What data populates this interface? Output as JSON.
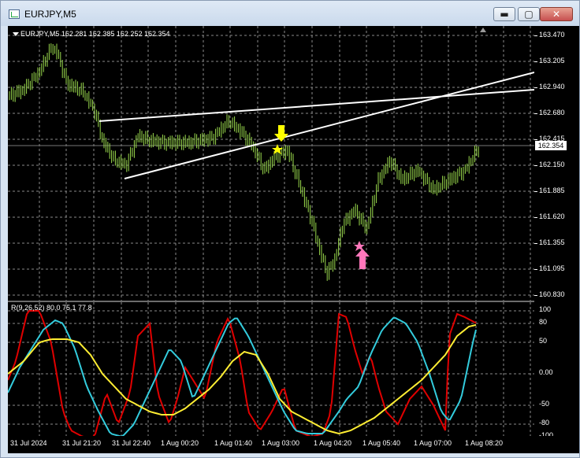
{
  "window": {
    "title": "EURJPY,M5",
    "minimize_glyph": "▬",
    "maximize_glyph": "▢",
    "close_glyph": "✕"
  },
  "header": {
    "text": "EURJPY,M5  162.281 162.385 162.252 162.354"
  },
  "indicator": {
    "header": "R(9,26,52) 80.0 75.1 77.8"
  },
  "price_tag": "162.354",
  "price_scale": [
    "163.470",
    "163.205",
    "162.940",
    "162.680",
    "162.415",
    "162.150",
    "161.885",
    "161.620",
    "161.355",
    "161.095",
    "160.830"
  ],
  "ind_scale": [
    "100",
    "80",
    "50",
    "0.00",
    "-50",
    "-80",
    "-100"
  ],
  "time_axis": [
    "31 Jul 2024",
    "31 Jul 21:20",
    "31 Jul 22:40",
    "1 Aug 00:20",
    "1 Aug 01:40",
    "1 Aug 03:00",
    "1 Aug 04:20",
    "1 Aug 05:40",
    "1 Aug 07:00",
    "1 Aug 08:20"
  ],
  "colors": {
    "candle": "#9bdb4d",
    "trendline": "#ffffff",
    "down_arrow": "#ffff00",
    "up_arrow": "#ff77bb",
    "series_red": "#e00000",
    "series_cyan": "#33ccdd",
    "series_yellow": "#ffee33",
    "grid": "#8a8a8a"
  },
  "icons": [
    "app-icon",
    "collapse-triangle-icon",
    "pin-icon",
    "down-arrow-icon",
    "up-arrow-icon",
    "star-icon"
  ],
  "chart_data": {
    "type": "line",
    "title": "EURJPY,M5",
    "ylim": [
      160.83,
      163.47
    ],
    "x": [
      "31 Jul 2024",
      "31 Jul 21:20",
      "31 Jul 22:40",
      "1 Aug 00:20",
      "1 Aug 01:40",
      "1 Aug 03:00",
      "1 Aug 04:20",
      "1 Aug 05:40",
      "1 Aug 07:00",
      "1 Aug 08:20"
    ],
    "series": [
      {
        "name": "",
        "values": [
          162.78,
          162.2,
          162.34,
          162.5,
          162.49,
          162.0,
          161.13,
          162.15,
          161.85,
          162.35
        ]
      }
    ],
    "indicator": {
      "ylim": [
        -100,
        100
      ],
      "series": [
        {
          "name": "",
          "values": [
            -10,
            -80,
            70,
            -40,
            80,
            30,
            -100,
            80,
            -60,
            80
          ]
        },
        {
          "name": "",
          "values": [
            30,
            60,
            -90,
            40,
            60,
            -60,
            -95,
            90,
            -30,
            75
          ]
        },
        {
          "name": "",
          "values": [
            50,
            60,
            -20,
            -60,
            -60,
            -70,
            -95,
            -60,
            0,
            78
          ]
        }
      ]
    }
  }
}
